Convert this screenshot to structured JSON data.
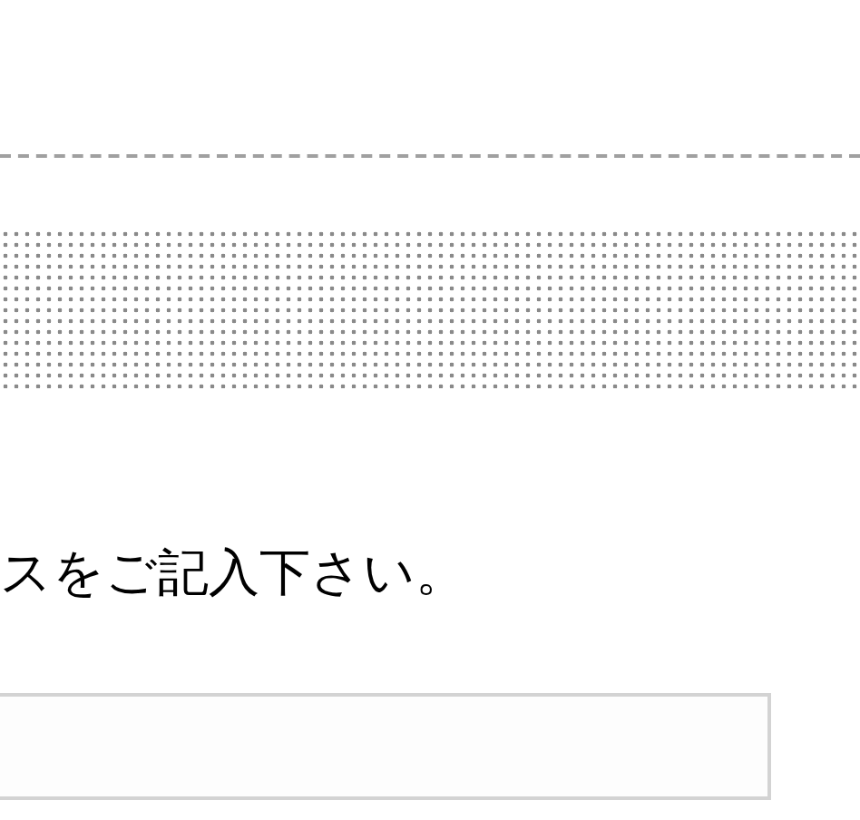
{
  "instruction": "スをご記入下さい。"
}
